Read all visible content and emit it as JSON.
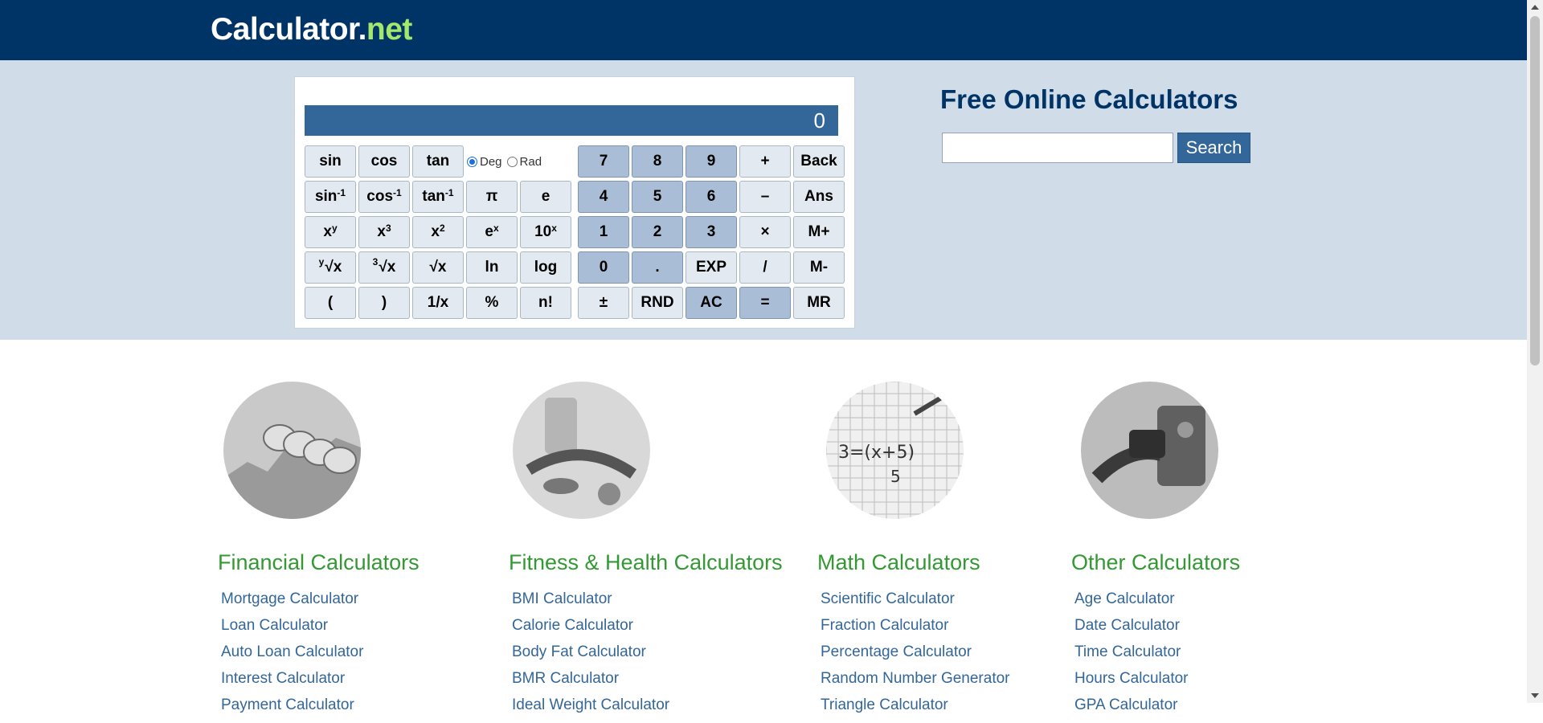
{
  "header": {
    "logo_main": "Calculator",
    "logo_dot": ".",
    "logo_net": "net"
  },
  "calculator": {
    "display": "0",
    "angle": {
      "deg": "Deg",
      "rad": "Rad",
      "selected": "Deg"
    },
    "sci_rows": [
      [
        {
          "label": "sin"
        },
        {
          "label": "cos"
        },
        {
          "label": "tan"
        }
      ],
      [
        {
          "label": "sin",
          "sup": "-1"
        },
        {
          "label": "cos",
          "sup": "-1"
        },
        {
          "label": "tan",
          "sup": "-1"
        },
        {
          "label": "π"
        },
        {
          "label": "e"
        }
      ],
      [
        {
          "label": "x",
          "sup": "y"
        },
        {
          "label": "x",
          "sup": "3"
        },
        {
          "label": "x",
          "sup": "2"
        },
        {
          "label": "e",
          "sup": "x"
        },
        {
          "label": "10",
          "sup": "x"
        }
      ],
      [
        {
          "pre": "y",
          "label": "√x"
        },
        {
          "pre": "3",
          "label": "√x"
        },
        {
          "label": "√x"
        },
        {
          "label": "ln"
        },
        {
          "label": "log"
        }
      ],
      [
        {
          "label": "("
        },
        {
          "label": ")"
        },
        {
          "label": "1/x"
        },
        {
          "label": "%"
        },
        {
          "label": "n!"
        }
      ]
    ],
    "num_rows": [
      [
        {
          "label": "7",
          "num": true
        },
        {
          "label": "8",
          "num": true
        },
        {
          "label": "9",
          "num": true
        },
        {
          "label": "+"
        },
        {
          "label": "Back"
        }
      ],
      [
        {
          "label": "4",
          "num": true
        },
        {
          "label": "5",
          "num": true
        },
        {
          "label": "6",
          "num": true
        },
        {
          "label": "–"
        },
        {
          "label": "Ans"
        }
      ],
      [
        {
          "label": "1",
          "num": true
        },
        {
          "label": "2",
          "num": true
        },
        {
          "label": "3",
          "num": true
        },
        {
          "label": "×"
        },
        {
          "label": "M+"
        }
      ],
      [
        {
          "label": "0",
          "num": true
        },
        {
          "label": ".",
          "num": true
        },
        {
          "label": "EXP"
        },
        {
          "label": "/"
        },
        {
          "label": "M-"
        }
      ],
      [
        {
          "label": "±"
        },
        {
          "label": "RND"
        },
        {
          "label": "AC",
          "num": true
        },
        {
          "label": "=",
          "num": true
        },
        {
          "label": "MR"
        }
      ]
    ]
  },
  "sidebar": {
    "title": "Free Online Calculators",
    "search_value": "",
    "search_button": "Search"
  },
  "categories": [
    {
      "id": "financial",
      "title": "Financial Calculators",
      "image_icon": "coins-chart-photo",
      "links": [
        "Mortgage Calculator",
        "Loan Calculator",
        "Auto Loan Calculator",
        "Interest Calculator",
        "Payment Calculator"
      ]
    },
    {
      "id": "fitness",
      "title": "Fitness & Health Calculators",
      "image_icon": "fitness-food-photo",
      "links": [
        "BMI Calculator",
        "Calorie Calculator",
        "Body Fat Calculator",
        "BMR Calculator",
        "Ideal Weight Calculator"
      ]
    },
    {
      "id": "math",
      "title": "Math Calculators",
      "image_icon": "math-formula-photo",
      "links": [
        "Scientific Calculator",
        "Fraction Calculator",
        "Percentage Calculator",
        "Random Number Generator",
        "Triangle Calculator"
      ]
    },
    {
      "id": "other",
      "title": "Other Calculators",
      "image_icon": "fuel-pump-photo",
      "links": [
        "Age Calculator",
        "Date Calculator",
        "Time Calculator",
        "Hours Calculator",
        "GPA Calculator"
      ]
    }
  ],
  "colors": {
    "header": "#003366",
    "hero": "#d0dce8",
    "accent": "#336699",
    "category_title": "#339933",
    "link": "#336699",
    "logo_net": "#a2e86c"
  }
}
